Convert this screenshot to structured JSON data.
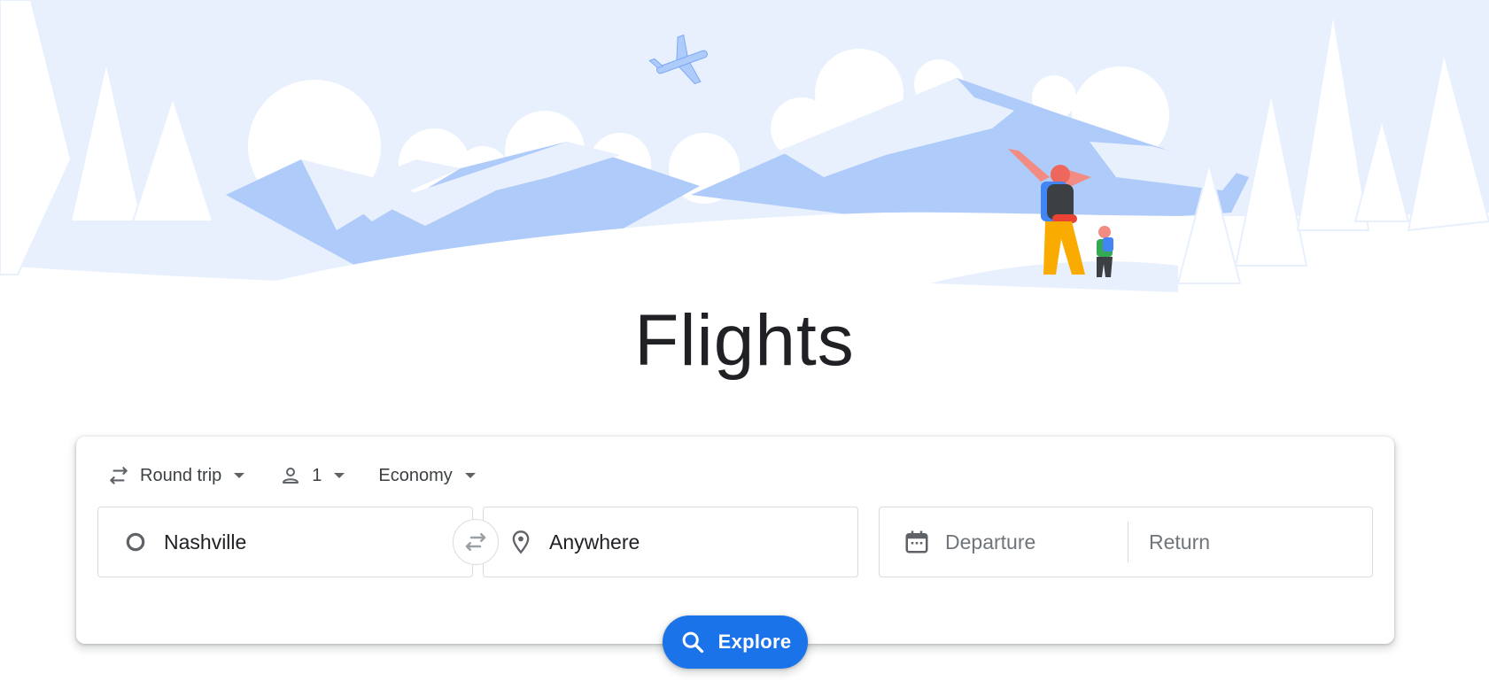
{
  "page": {
    "title": "Flights"
  },
  "trip_options": {
    "trip_type": {
      "label": "Round trip",
      "icon": "swap-horiz-icon"
    },
    "passengers": {
      "label": "1",
      "icon": "person-icon"
    },
    "cabin_class": {
      "label": "Economy"
    }
  },
  "search": {
    "origin": {
      "value": "Nashville",
      "icon": "origin-circle-icon"
    },
    "destination": {
      "value": "Anywhere",
      "icon": "location-pin-icon"
    },
    "departure": {
      "placeholder": "Departure",
      "icon": "calendar-icon"
    },
    "return": {
      "placeholder": "Return"
    }
  },
  "actions": {
    "explore_label": "Explore"
  },
  "colors": {
    "accent": "#1a73e8",
    "illustration_sky": "#e8f0fe",
    "illustration_mountain": "#aecbfa",
    "text_primary": "#202124",
    "text_secondary": "#70757a"
  }
}
